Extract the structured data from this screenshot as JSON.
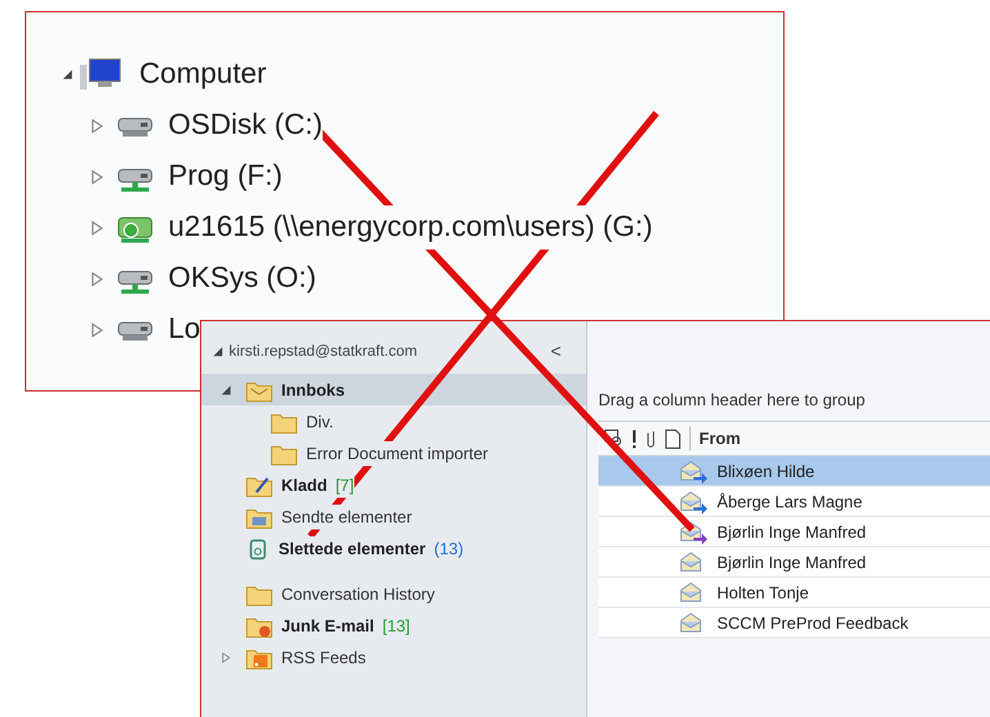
{
  "explorer": {
    "root": {
      "label": "Computer",
      "expanded": true,
      "children": [
        {
          "label": "OSDisk (C:)",
          "kind": "disk",
          "expanded": false
        },
        {
          "label": "Prog (F:)",
          "kind": "network",
          "expanded": false
        },
        {
          "label": "u21615 (\\\\energycorp.com\\users) (G:)",
          "kind": "home",
          "expanded": false
        },
        {
          "label": "OKSys (O:)",
          "kind": "network",
          "expanded": false
        },
        {
          "label": "Lo",
          "kind": "disk",
          "expanded": false
        }
      ]
    }
  },
  "outlook": {
    "account": {
      "label": "kirsti.repstad@statkraft.com",
      "expanded": true
    },
    "collapse_glyph": "<",
    "folders": [
      {
        "label": "Innboks",
        "kind": "inbox",
        "bold": true,
        "selected": true,
        "expanded": true,
        "children": [
          {
            "label": "Div.",
            "kind": "folder",
            "bold": false,
            "selected": false
          },
          {
            "label": "Error Document importer",
            "kind": "folder",
            "bold": false,
            "selected": false
          }
        ]
      },
      {
        "label": "Kladd",
        "count": "[7]",
        "kind": "drafts",
        "bold": true,
        "selected": false
      },
      {
        "label": "Sendte elementer",
        "kind": "sent",
        "bold": false,
        "selected": false
      },
      {
        "label": "Slettede elementer",
        "count": "(13)",
        "kind": "deleted",
        "bold": true,
        "selected": false
      },
      {
        "label": "Conversation History",
        "kind": "folder",
        "bold": false,
        "selected": false,
        "gap": true
      },
      {
        "label": "Junk E-mail",
        "count": "[13]",
        "kind": "junk",
        "bold": true,
        "selected": false
      },
      {
        "label": "RSS Feeds",
        "kind": "rss",
        "bold": false,
        "selected": false,
        "expanded": false
      }
    ],
    "group_hint": "Drag a column header here to group",
    "columns": [
      {
        "kind": "reminder"
      },
      {
        "kind": "importance"
      },
      {
        "kind": "attachment"
      },
      {
        "kind": "document"
      },
      {
        "kind": "text",
        "label": "From"
      }
    ],
    "rows": [
      {
        "from": "Blixøen Hilde",
        "kind": "reply",
        "selected": true
      },
      {
        "from": "Åberge Lars Magne",
        "kind": "reply",
        "selected": false
      },
      {
        "from": "Bjørlin Inge Manfred",
        "kind": "forward",
        "selected": false
      },
      {
        "from": "Bjørlin Inge Manfred",
        "kind": "read",
        "selected": false
      },
      {
        "from": "Holten Tonje",
        "kind": "read",
        "selected": false
      },
      {
        "from": "SCCM PreProd Feedback",
        "kind": "read",
        "selected": false
      }
    ]
  }
}
